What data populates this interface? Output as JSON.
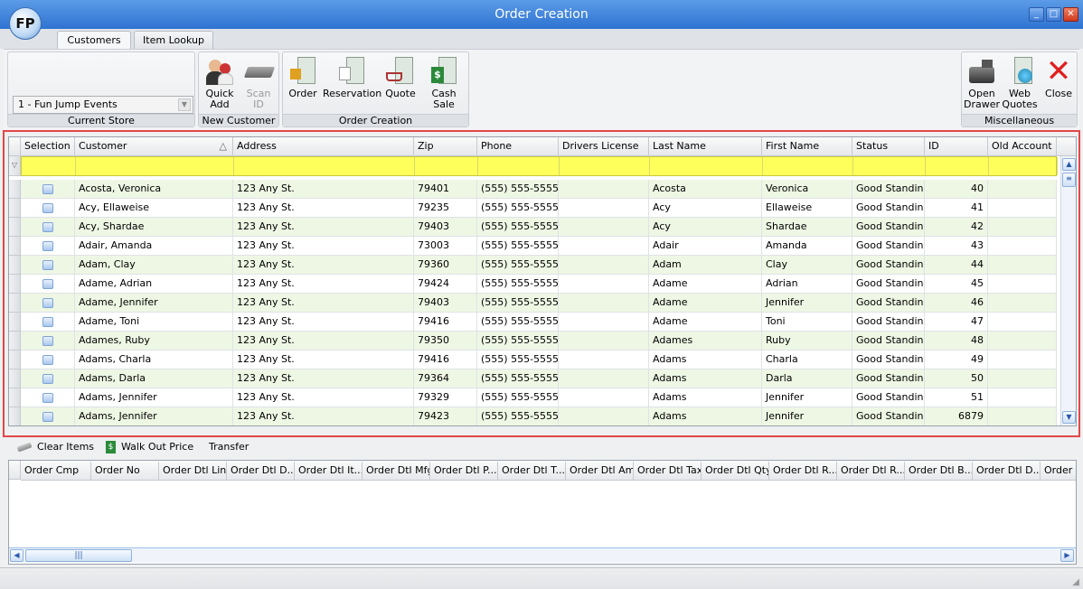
{
  "window": {
    "title": "Order Creation",
    "logo": "FP",
    "minimize": "_",
    "maximize": "□",
    "close": "✕"
  },
  "tabs": [
    {
      "label": "Customers",
      "active": true
    },
    {
      "label": "Item Lookup",
      "active": false
    }
  ],
  "ribbon": {
    "current_store": {
      "label": "Current Store",
      "value": "1 - Fun Jump Events"
    },
    "new_customer": {
      "label": "New Customer",
      "quick_add": "Quick Add",
      "scan_id": "Scan ID"
    },
    "order_creation": {
      "label": "Order Creation",
      "order": "Order",
      "reservation": "Reservation",
      "quote": "Quote",
      "cash_sale": "Cash Sale"
    },
    "misc": {
      "label": "Miscellaneous",
      "open_drawer": "Open Drawer",
      "web_quotes": "Web Quotes",
      "close": "Close"
    }
  },
  "customers_grid": {
    "columns": [
      "Selection",
      "Customer",
      "Address",
      "Zip",
      "Phone",
      "Drivers License",
      "Last Name",
      "First Name",
      "Status",
      "ID",
      "Old Account"
    ],
    "sort_indicator": "△",
    "rows": [
      [
        "",
        "Acosta, Veronica",
        "123 Any St.",
        "79401",
        "(555) 555-5555",
        "",
        "Acosta",
        "Veronica",
        "Good Standing",
        "40",
        ""
      ],
      [
        "",
        "Acy, Ellaweise",
        "123 Any St.",
        "79235",
        "(555) 555-5555",
        "",
        "Acy",
        "Ellaweise",
        "Good Standing",
        "41",
        ""
      ],
      [
        "",
        "Acy, Shardae",
        "123 Any St.",
        "79403",
        "(555) 555-5555",
        "",
        "Acy",
        "Shardae",
        "Good Standing",
        "42",
        ""
      ],
      [
        "",
        "Adair, Amanda",
        "123 Any St.",
        "73003",
        "(555) 555-5555",
        "",
        "Adair",
        "Amanda",
        "Good Standing",
        "43",
        ""
      ],
      [
        "",
        "Adam, Clay",
        "123 Any St.",
        "79360",
        "(555) 555-5555",
        "",
        "Adam",
        "Clay",
        "Good Standing",
        "44",
        ""
      ],
      [
        "",
        "Adame, Adrian",
        "123 Any St.",
        "79424",
        "(555) 555-5555",
        "",
        "Adame",
        "Adrian",
        "Good Standing",
        "45",
        ""
      ],
      [
        "",
        "Adame, Jennifer",
        "123 Any St.",
        "79403",
        "(555) 555-5555",
        "",
        "Adame",
        "Jennifer",
        "Good Standing",
        "46",
        ""
      ],
      [
        "",
        "Adame, Toni",
        "123 Any St.",
        "79416",
        "(555) 555-5555",
        "",
        "Adame",
        "Toni",
        "Good Standing",
        "47",
        ""
      ],
      [
        "",
        "Adames, Ruby",
        "123 Any St.",
        "79350",
        "(555) 555-5555",
        "",
        "Adames",
        "Ruby",
        "Good Standing",
        "48",
        ""
      ],
      [
        "",
        "Adams, Charla",
        "123 Any St.",
        "79416",
        "(555) 555-5555",
        "",
        "Adams",
        "Charla",
        "Good Standing",
        "49",
        ""
      ],
      [
        "",
        "Adams, Darla",
        "123 Any St.",
        "79364",
        "(555) 555-5555",
        "",
        "Adams",
        "Darla",
        "Good Standing",
        "50",
        ""
      ],
      [
        "",
        "Adams, Jennifer",
        "123 Any St.",
        "79329",
        "(555) 555-5555",
        "",
        "Adams",
        "Jennifer",
        "Good Standing",
        "51",
        ""
      ],
      [
        "",
        "Adams, Jennifer",
        "123 Any St.",
        "79423",
        "(555) 555-5555",
        "",
        "Adams",
        "Jennifer",
        "Good Standing",
        "6879",
        ""
      ]
    ]
  },
  "lower_toolbar": {
    "clear_items": "Clear Items",
    "walk_out_price": "Walk Out Price",
    "transfer": "Transfer"
  },
  "order_grid": {
    "columns": [
      "Order Cmp",
      "Order No",
      "Order Dtl Line",
      "Order Dtl D...",
      "Order Dtl It...",
      "Order Dtl Mfg",
      "Order Dtl P...",
      "Order Dtl T...",
      "Order Dtl Amt",
      "Order Dtl Tax",
      "Order Dtl Qty",
      "Order Dtl R...",
      "Order Dtl R...",
      "Order Dtl B...",
      "Order Dtl D...",
      "Order D"
    ]
  },
  "colors": {
    "title_bar": "#2f73d2",
    "filter_row": "#ffff5c",
    "alt_row": "#eef7e4",
    "highlight_frame": "#e34848"
  }
}
